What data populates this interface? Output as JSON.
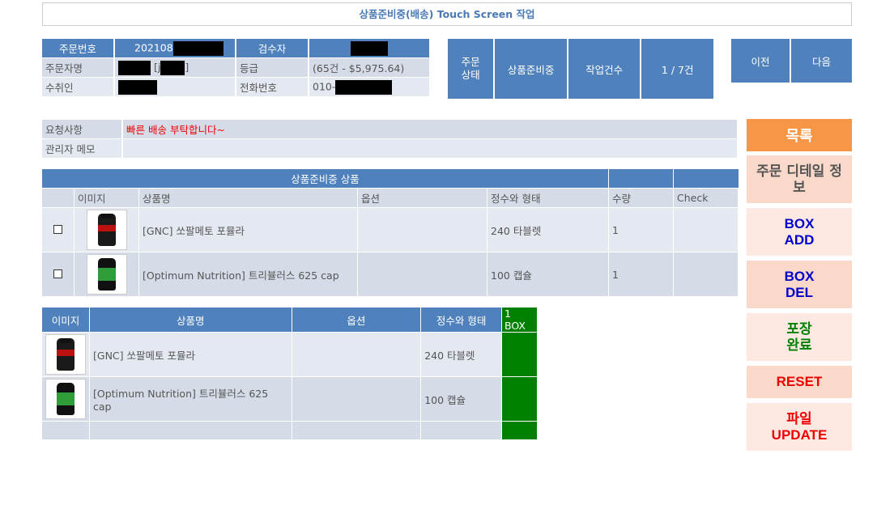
{
  "page_title": "상품준비중(배송) Touch Screen 작업",
  "order_info": {
    "order_no_label": "주문번호",
    "order_no_value": "202108",
    "inspector_label": "검수자",
    "orderer_label": "주문자명",
    "orderer_bracket_open": "[j",
    "orderer_bracket_close": "]",
    "grade_label": "등급",
    "grade_value": "(65건 - $5,975.64)",
    "recipient_label": "수취인",
    "phone_label": "전화번호",
    "phone_prefix": "010-"
  },
  "status": {
    "order_status_label": "주문\n상태",
    "order_status_value": "상품준비중",
    "work_count_label": "작업건수",
    "work_count_value": "1 / 7건"
  },
  "nav": {
    "prev": "이전",
    "next": "다음"
  },
  "request": {
    "request_label": "요청사항",
    "request_value": "빠른 배송 부탁합니다~",
    "memo_label": "관리자 메모",
    "memo_value": ""
  },
  "products": {
    "title": "상품준비중 상품",
    "columns": [
      "",
      "이미지",
      "상품명",
      "옵션",
      "정수와 형태",
      "수량",
      "Check"
    ],
    "rows": [
      {
        "name": "[GNC] 쏘팔메토 포뮬라",
        "option": "",
        "form": "240 타블렛",
        "qty": "1",
        "check": ""
      },
      {
        "name": "[Optimum Nutrition] 트리뷸러스 625 cap",
        "option": "",
        "form": "100 캡슐",
        "qty": "1",
        "check": ""
      }
    ]
  },
  "box": {
    "columns": [
      "이미지",
      "상품명",
      "옵션",
      "정수와 형태",
      "1 BOX"
    ],
    "rows": [
      {
        "name": "[GNC] 쏘팔메토 포뮬라",
        "option": "",
        "form": "240 타블렛"
      },
      {
        "name": "[Optimum Nutrition] 트리뷸러스 625 cap",
        "option": "",
        "form": "100 캡슐"
      }
    ]
  },
  "side_buttons": {
    "list": "목록",
    "order_detail": "주문 디테일 정보",
    "box_add_1": "BOX",
    "box_add_2": "ADD",
    "box_del_1": "BOX",
    "box_del_2": "DEL",
    "pack_done_1": "포장",
    "pack_done_2": "완료",
    "reset": "RESET",
    "file_update_1": "파일",
    "file_update_2": "UPDATE"
  },
  "colors": {
    "header_blue": "#4f81bd",
    "row_gray": "#d6dbe8",
    "list_orange": "#f79646",
    "box_green": "#008000",
    "request_red": "#ff0000"
  }
}
